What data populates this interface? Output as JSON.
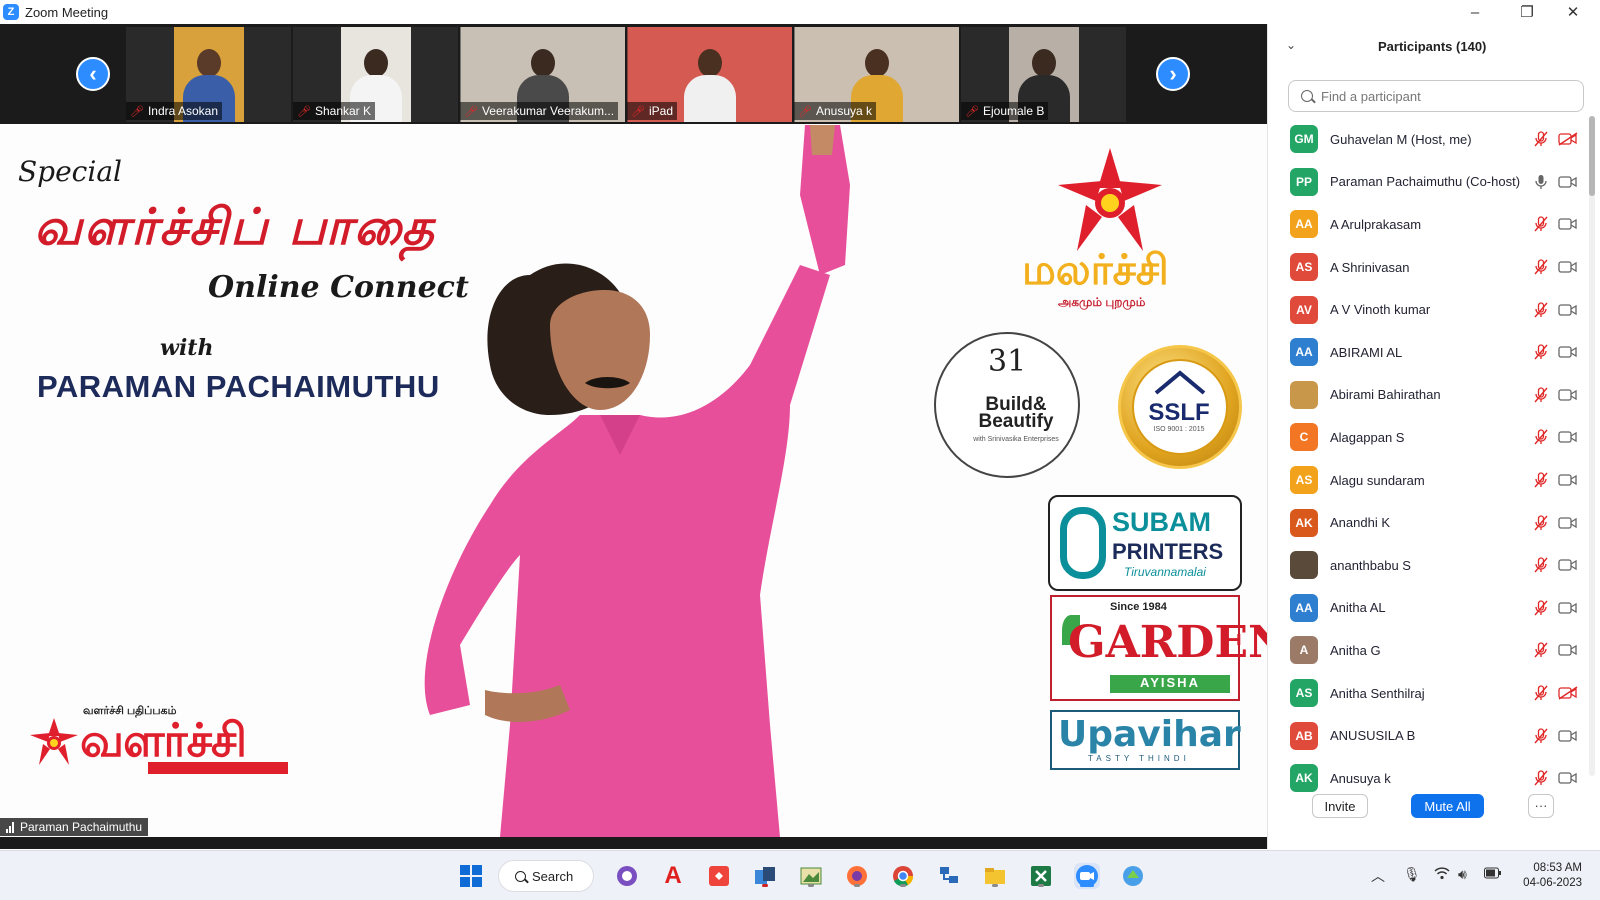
{
  "window": {
    "title": "Zoom Meeting"
  },
  "video_strip": {
    "tiles": [
      {
        "name": "Indra Asokan"
      },
      {
        "name": "Shankar K"
      },
      {
        "name": "Veerakumar Veerakum..."
      },
      {
        "name": "iPad"
      },
      {
        "name": "Anusuya k"
      },
      {
        "name": "Ejoumale B"
      }
    ]
  },
  "stage": {
    "special": "Special",
    "tamil_title": "வளர்ச்சிப் பாதை",
    "online_connect": "Online Connect",
    "with": "with",
    "host": "PARAMAN PACHAIMUTHU",
    "valarchi_small": "வளர்ச்சி பதிப்பகம்",
    "valarchi_big": "வளர்ச்சி",
    "malarchi": "மலர்ச்சி",
    "malarchi_sub": "அகமும் புறமும்",
    "build_num": "31",
    "build_text": "Build& Beautify",
    "build_sub": "with Srinivasika Enterprises",
    "sslf": "SSLF",
    "sslf_iso": "ISO 9001 : 2015",
    "subam_1": "SUBAM",
    "subam_2": "PRINTERS",
    "subam_3": "Tiruvannamalai",
    "garden_since": "Since 1984",
    "garden": "GARDEN",
    "garden_sub": "AYISHA",
    "upavihar": "Upavihar",
    "upavihar_sub": "TASTY THINDI",
    "speaker": "Paraman Pachaimuthu"
  },
  "participants": {
    "title": "Participants (140)",
    "search_placeholder": "Find a participant",
    "list": [
      {
        "initials": "GM",
        "name": "Guhavelan M (Host, me)",
        "color": "#23a566",
        "mic": "muted",
        "cam": "off"
      },
      {
        "initials": "PP",
        "name": "Paraman Pachaimuthu (Co-host)",
        "color": "#23a566",
        "mic": "on",
        "cam": "on"
      },
      {
        "initials": "AA",
        "name": "A Arulprakasam",
        "color": "#f3a21b",
        "mic": "muted",
        "cam": "on"
      },
      {
        "initials": "AS",
        "name": "A Shrinivasan",
        "color": "#e04a3a",
        "mic": "muted",
        "cam": "on"
      },
      {
        "initials": "AV",
        "name": "A V Vinoth kumar",
        "color": "#e04a3a",
        "mic": "muted",
        "cam": "on"
      },
      {
        "initials": "AA",
        "name": "ABIRAMI AL",
        "color": "#2f7fd1",
        "mic": "muted",
        "cam": "on"
      },
      {
        "initials": "",
        "name": "Abirami Bahirathan",
        "color": "#c9974a",
        "mic": "muted",
        "cam": "on"
      },
      {
        "initials": "C",
        "name": "Alagappan S",
        "color": "#f27623",
        "mic": "muted",
        "cam": "on"
      },
      {
        "initials": "AS",
        "name": "Alagu sundaram",
        "color": "#f3a21b",
        "mic": "muted",
        "cam": "on"
      },
      {
        "initials": "AK",
        "name": "Anandhi K",
        "color": "#d9581c",
        "mic": "muted",
        "cam": "on"
      },
      {
        "initials": "",
        "name": "ananthbabu S",
        "color": "#5a4a3a",
        "mic": "muted",
        "cam": "on"
      },
      {
        "initials": "AA",
        "name": "Anitha AL",
        "color": "#2f7fd1",
        "mic": "muted",
        "cam": "on"
      },
      {
        "initials": "A",
        "name": "Anitha G",
        "color": "#9b7b68",
        "mic": "muted",
        "cam": "on"
      },
      {
        "initials": "AS",
        "name": "Anitha Senthilraj",
        "color": "#23a566",
        "mic": "muted",
        "cam": "off"
      },
      {
        "initials": "AB",
        "name": "ANUSUSILA B",
        "color": "#e04a3a",
        "mic": "muted",
        "cam": "on"
      },
      {
        "initials": "AK",
        "name": "Anusuya k",
        "color": "#23a566",
        "mic": "muted",
        "cam": "on"
      }
    ],
    "invite_label": "Invite",
    "mute_all_label": "Mute All",
    "more_label": "···"
  },
  "taskbar": {
    "search_label": "Search",
    "time": "08:53 AM",
    "date": "04-06-2023"
  },
  "colors": {
    "zoom_blue": "#2d8cff",
    "mute_all_blue": "#0e72ed",
    "mic_muted_red": "#e02828",
    "stage_pink": "#e84f9a"
  }
}
